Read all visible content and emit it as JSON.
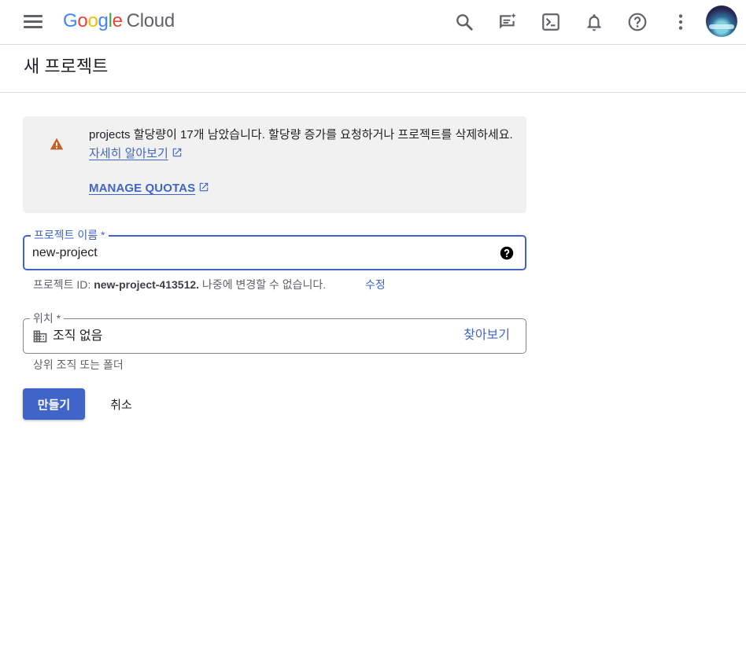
{
  "header": {
    "logo": {
      "g1": "G",
      "o1": "o",
      "o2": "o",
      "g2": "g",
      "l": "l",
      "e": "e",
      "product": "Cloud"
    },
    "icons": [
      "menu-icon",
      "search-icon",
      "gemini-chat-icon",
      "cloud-shell-icon",
      "notifications-icon",
      "help-icon",
      "more-vert-icon",
      "avatar"
    ]
  },
  "page": {
    "title": "새 프로젝트"
  },
  "quota_warning": {
    "text": "projects 할당량이 17개 남았습니다. 할당량 증가를 요청하거나 프로젝트를 삭제하세요.",
    "learn_more": "자세히 알아보기",
    "manage_quotas": "MANAGE QUOTAS"
  },
  "project_name": {
    "label": "프로젝트 이름 *",
    "value": "new-project"
  },
  "project_id_hint": {
    "prefix": "프로젝트 ID: ",
    "id": "new-project-413512.",
    "suffix": " 나중에 변경할 수 없습니다.",
    "edit": "수정"
  },
  "location": {
    "label": "위치 *",
    "value": "조직 없음",
    "browse": "찾아보기",
    "hint": "상위 조직 또는 폴더"
  },
  "actions": {
    "create": "만들기",
    "cancel": "취소"
  },
  "colors": {
    "accent": "#3f65c8",
    "warning": "#c5622a",
    "banner_bg": "#f1f1f1"
  }
}
